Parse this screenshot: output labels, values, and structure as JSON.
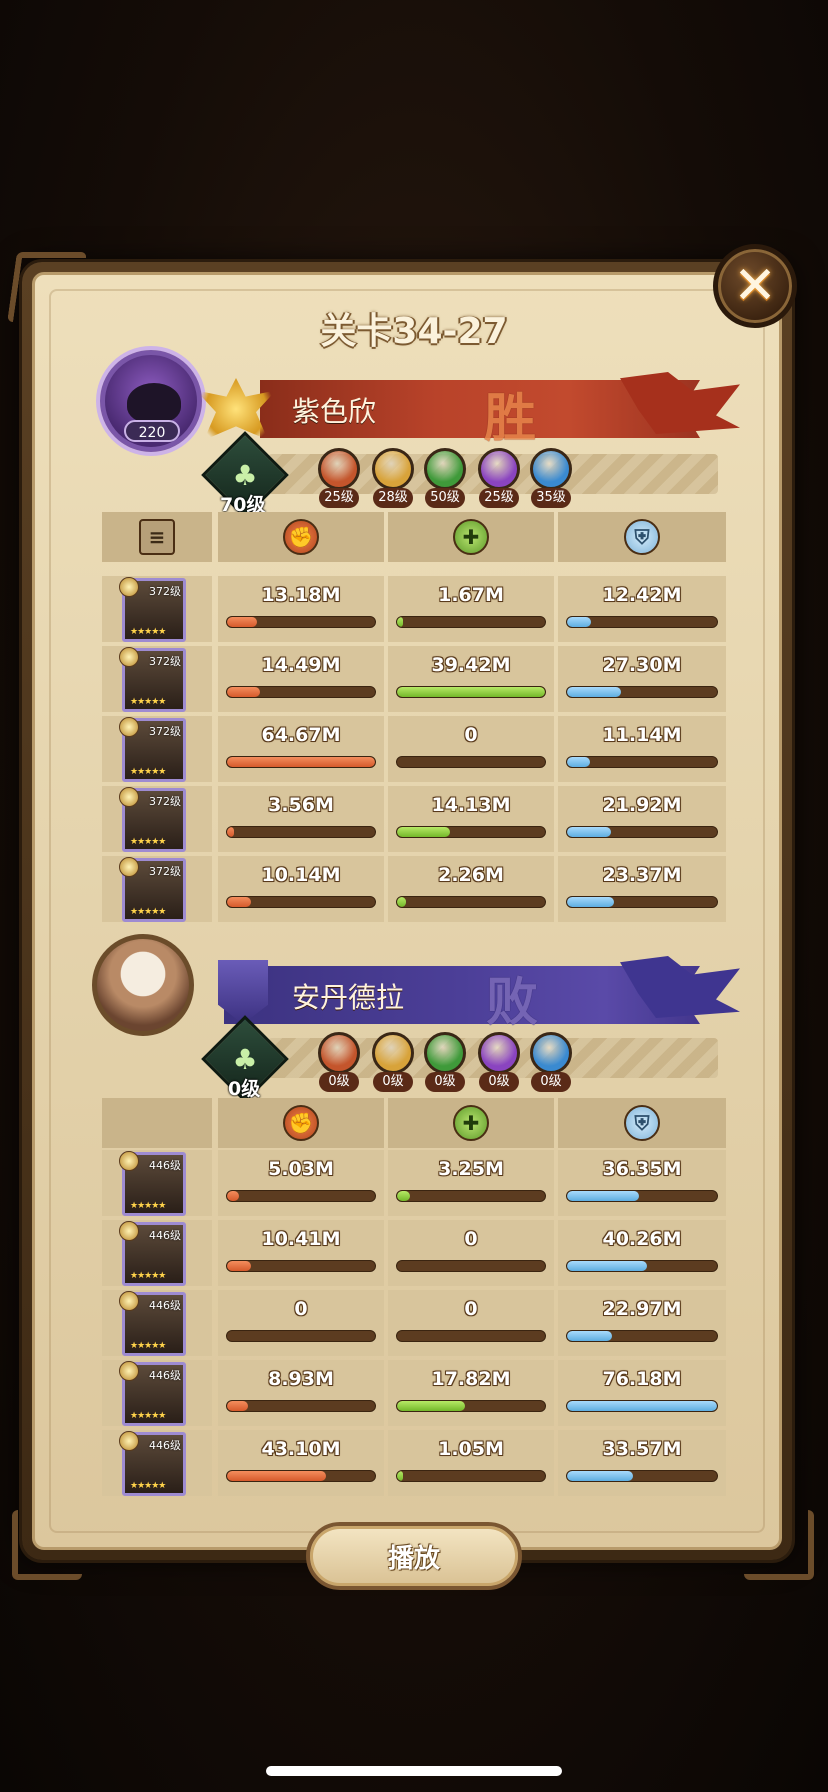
{
  "title": "关卡34-27",
  "player1": {
    "name": "紫色欣",
    "result": "胜",
    "avatar_level": "220",
    "tree_level": "70级",
    "factions": [
      {
        "level": "25级",
        "color": "#c4552c"
      },
      {
        "level": "28级",
        "color": "#d8a33a"
      },
      {
        "level": "50级",
        "color": "#3f9a3a"
      },
      {
        "level": "25级",
        "color": "#8a44c0"
      },
      {
        "level": "35级",
        "color": "#3a8ad0"
      }
    ],
    "heroes": [
      {
        "level": "372级",
        "stars": "★★★★★",
        "dmg": "13.18M",
        "dmg_pct": 0.2,
        "heal": "1.67M",
        "heal_pct": 0.04,
        "def": "12.42M",
        "def_pct": 0.16
      },
      {
        "level": "372级",
        "stars": "★★★★★",
        "dmg": "14.49M",
        "dmg_pct": 0.22,
        "heal": "39.42M",
        "heal_pct": 1.0,
        "def": "27.30M",
        "def_pct": 0.36
      },
      {
        "level": "372级",
        "stars": "★★★★★",
        "dmg": "64.67M",
        "dmg_pct": 1.0,
        "heal": "0",
        "heal_pct": 0,
        "def": "11.14M",
        "def_pct": 0.15
      },
      {
        "level": "372级",
        "stars": "★★★★★",
        "dmg": "3.56M",
        "dmg_pct": 0.05,
        "heal": "14.13M",
        "heal_pct": 0.36,
        "def": "21.92M",
        "def_pct": 0.29
      },
      {
        "level": "372级",
        "stars": "★★★★★",
        "dmg": "10.14M",
        "dmg_pct": 0.16,
        "heal": "2.26M",
        "heal_pct": 0.06,
        "def": "23.37M",
        "def_pct": 0.31
      }
    ]
  },
  "player2": {
    "name": "安丹德拉",
    "result": "败",
    "tree_level": "0级",
    "factions": [
      {
        "level": "0级",
        "color": "#c4552c"
      },
      {
        "level": "0级",
        "color": "#d8a33a"
      },
      {
        "level": "0级",
        "color": "#3f9a3a"
      },
      {
        "level": "0级",
        "color": "#8a44c0"
      },
      {
        "level": "0级",
        "color": "#3a8ad0"
      }
    ],
    "heroes": [
      {
        "level": "446级",
        "stars": "★★★★★",
        "dmg": "5.03M",
        "dmg_pct": 0.08,
        "heal": "3.25M",
        "heal_pct": 0.09,
        "def": "36.35M",
        "def_pct": 0.48
      },
      {
        "level": "446级",
        "stars": "★★★★★",
        "dmg": "10.41M",
        "dmg_pct": 0.16,
        "heal": "0",
        "heal_pct": 0,
        "def": "40.26M",
        "def_pct": 0.53
      },
      {
        "level": "446级",
        "stars": "★★★★★",
        "dmg": "0",
        "dmg_pct": 0,
        "heal": "0",
        "heal_pct": 0,
        "def": "22.97M",
        "def_pct": 0.3
      },
      {
        "level": "446级",
        "stars": "★★★★★",
        "dmg": "8.93M",
        "dmg_pct": 0.14,
        "heal": "17.82M",
        "heal_pct": 0.46,
        "def": "76.18M",
        "def_pct": 1.0
      },
      {
        "level": "446级",
        "stars": "★★★★★",
        "dmg": "43.10M",
        "dmg_pct": 0.67,
        "heal": "1.05M",
        "heal_pct": 0.03,
        "def": "33.57M",
        "def_pct": 0.44
      }
    ]
  },
  "icons": {
    "close": "✕",
    "damage": "damage-icon",
    "heal": "heal-icon",
    "defense": "shield-icon",
    "detail": "document-icon"
  },
  "play_button": "播放"
}
